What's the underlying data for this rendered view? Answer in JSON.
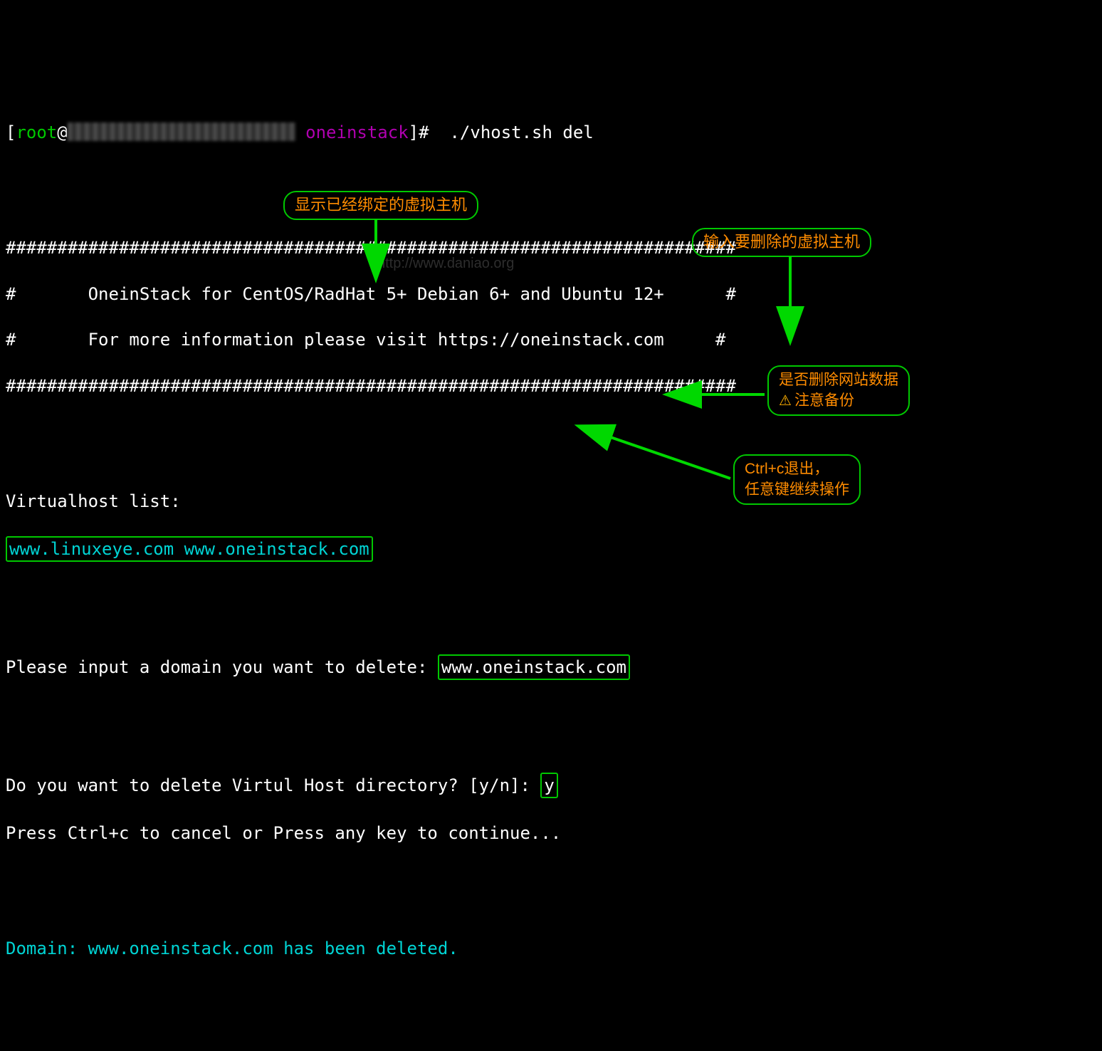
{
  "prompt": {
    "lbracket": "[",
    "user": "root",
    "at": "@",
    "dir": "oneinstack",
    "rbracket": "]# ",
    "command": " ./vhost.sh del"
  },
  "banner": {
    "line1hash": "#######################################################################",
    "line2": "#       OneinStack for CentOS/RadHat 5+ Debian 6+ and Ubuntu 12+      #",
    "line3": "#       For more information please visit https://oneinstack.com     #",
    "line4hash": "#######################################################################"
  },
  "vhost": {
    "label": "Virtualhost list:",
    "list": "www.linuxeye.com www.oneinstack.com"
  },
  "inputDomain": {
    "prompt": "Please input a domain you want to delete: ",
    "value": "www.oneinstack.com"
  },
  "confirmDir": {
    "prompt": "Do you want to delete Virtul Host directory? [y/n]: ",
    "value": "y"
  },
  "continue": "Press Ctrl+c to cancel or Press any key to continue...",
  "result": "Domain: www.oneinstack.com has been deleted.",
  "watermark": "http://www.daniao.org",
  "annotations": {
    "a1": "显示已经绑定的虚拟主机",
    "a2": "输入要删除的虚拟主机",
    "a3_line1": "是否删除网站数据",
    "a3_line2": "注意备份",
    "a4_line1": "Ctrl+c退出，",
    "a4_line2": "任意键继续操作"
  }
}
